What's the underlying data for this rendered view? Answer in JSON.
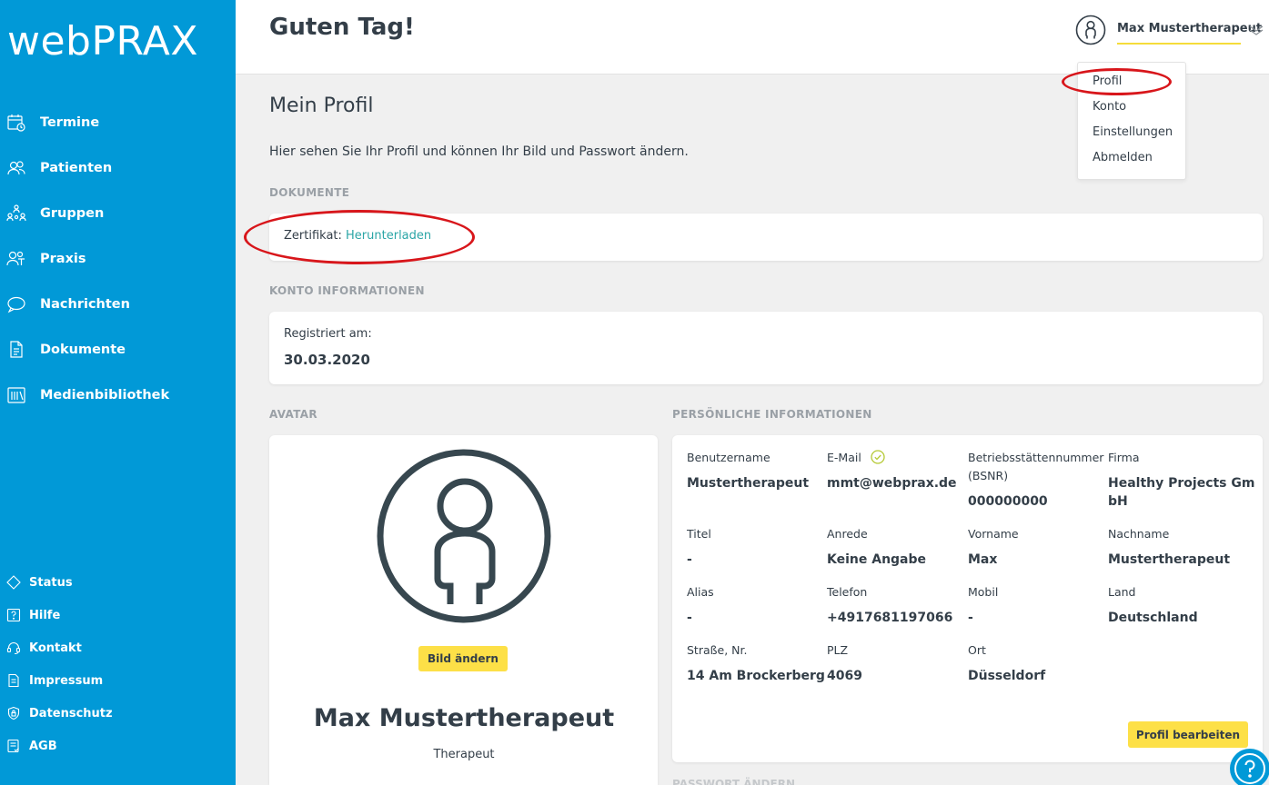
{
  "app": {
    "logo": "webPRAX"
  },
  "sidebar": {
    "items": [
      {
        "label": "Termine",
        "icon": "calendar-icon"
      },
      {
        "label": "Patienten",
        "icon": "patients-icon"
      },
      {
        "label": "Gruppen",
        "icon": "groups-icon"
      },
      {
        "label": "Praxis",
        "icon": "practice-icon"
      },
      {
        "label": "Nachrichten",
        "icon": "chat-bubble-icon"
      },
      {
        "label": "Dokumente",
        "icon": "documents-icon"
      },
      {
        "label": "Medienbibliothek",
        "icon": "media-library-icon"
      }
    ],
    "footer": [
      {
        "label": "Status",
        "icon": "status-diamond-icon"
      },
      {
        "label": "Hilfe",
        "icon": "help-icon"
      },
      {
        "label": "Kontakt",
        "icon": "contact-headset-icon"
      },
      {
        "label": "Impressum",
        "icon": "imprint-icon"
      },
      {
        "label": "Datenschutz",
        "icon": "privacy-icon"
      },
      {
        "label": "AGB",
        "icon": "terms-icon"
      }
    ]
  },
  "header": {
    "greeting": "Guten Tag!",
    "user_name": "Max Mustertherapeut"
  },
  "user_menu": {
    "items": [
      "Profil",
      "Konto",
      "Einstellungen",
      "Abmelden"
    ]
  },
  "page": {
    "title": "Mein Profil",
    "intro": "Hier sehen Sie Ihr Profil und können Ihr Bild und Passwort ändern."
  },
  "documents": {
    "section": "DOKUMENTE",
    "cert_label": "Zertifikat:",
    "cert_link": "Herunterladen"
  },
  "account": {
    "section": "KONTO INFORMATIONEN",
    "registered_label": "Registriert am:",
    "registered_value": "30.03.2020"
  },
  "avatar": {
    "section": "AVATAR",
    "change_button": "Bild ändern",
    "name": "Max Mustertherapeut",
    "role": "Therapeut"
  },
  "personal": {
    "section": "PERSÖNLICHE INFORMATIONEN",
    "username_label": "Benutzername",
    "username_value": "Mustertherapeut",
    "email_label": "E-Mail",
    "email_value": "mmt@webprax.de",
    "bsnr_label_1": "Betriebsstättennummer",
    "bsnr_label_2": "(BSNR)",
    "bsnr_value": "000000000",
    "company_label": "Firma",
    "company_value_1": "Healthy Projects Gm",
    "company_value_2": "bH",
    "title_label": "Titel",
    "title_value": "-",
    "salutation_label": "Anrede",
    "salutation_value": "Keine Angabe",
    "firstname_label": "Vorname",
    "firstname_value": "Max",
    "lastname_label": "Nachname",
    "lastname_value": "Mustertherapeut",
    "alias_label": "Alias",
    "alias_value": "-",
    "phone_label": "Telefon",
    "phone_value": "+4917681197066",
    "mobile_label": "Mobil",
    "mobile_value": "-",
    "country_label": "Land",
    "country_value": "Deutschland",
    "street_label": "Straße, Nr.",
    "street_value": "14 Am Brockerberg",
    "zip_label": "PLZ",
    "zip_value": "4069",
    "city_label": "Ort",
    "city_value": "Düsseldorf",
    "edit_button": "Profil bearbeiten"
  },
  "password": {
    "section": "PASSWORT ÄNDERN"
  },
  "colors": {
    "sidebar": "#0199d7",
    "accent_yellow": "#fde047",
    "link": "#2aa5a6",
    "annotation_red": "#d8161b"
  }
}
